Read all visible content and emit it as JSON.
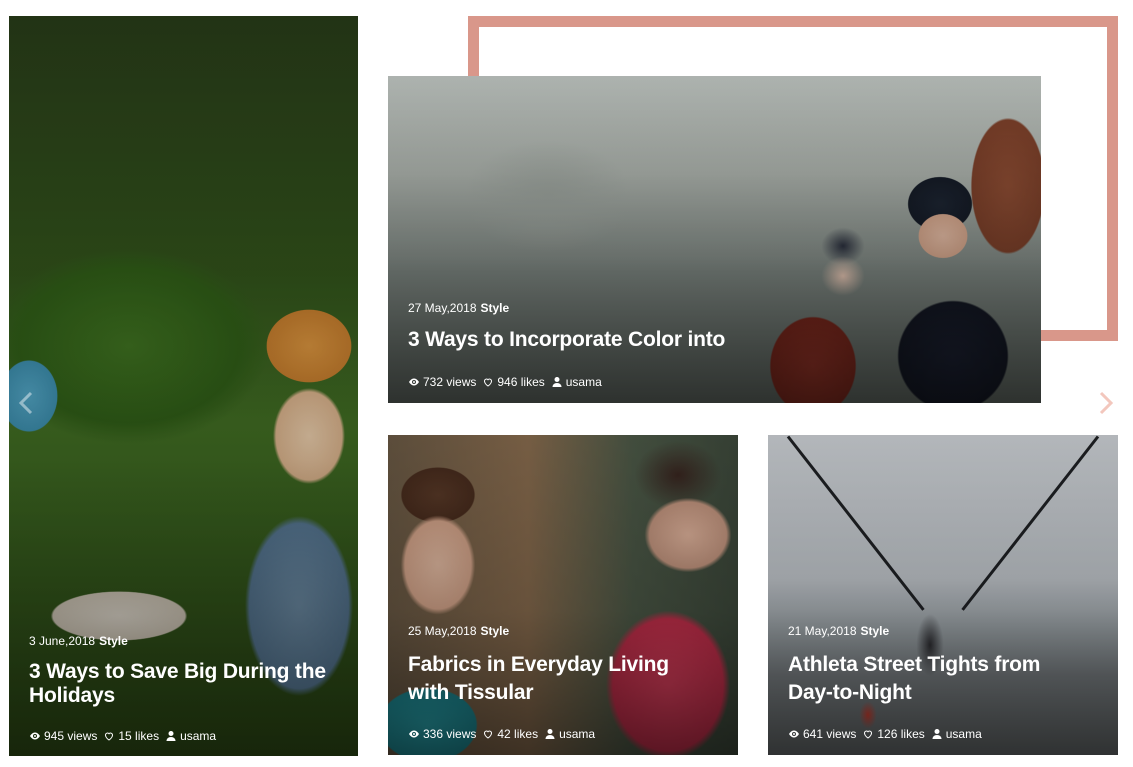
{
  "posts": [
    {
      "date": "3 June,2018",
      "category": "Style",
      "title_lines": [
        "3 Ways to Save Big During the",
        "Holidays"
      ],
      "views": "945 views",
      "likes": "15 likes",
      "author": "usama"
    },
    {
      "date": "27 May,2018",
      "category": "Style",
      "title_lines": [
        "3 Ways to Incorporate Color into"
      ],
      "views": "732 views",
      "likes": "946 likes",
      "author": "usama"
    },
    {
      "date": "25 May,2018",
      "category": "Style",
      "title_lines": [
        "Fabrics in Everyday Living",
        "with Tissular"
      ],
      "views": "336 views",
      "likes": "42 likes",
      "author": "usama"
    },
    {
      "date": "21 May,2018",
      "category": "Style",
      "title_lines": [
        "Athleta Street Tights from",
        "Day-to-Night"
      ],
      "views": "641 views",
      "likes": "126 likes",
      "author": "usama"
    }
  ],
  "icons": {
    "views": "eye-icon",
    "likes": "heart-icon",
    "author": "user-icon",
    "prev": "chevron-left-icon",
    "next": "chevron-right-icon"
  },
  "colors": {
    "frame": "#d9978a",
    "next_arrow": "#f3c7bd"
  }
}
